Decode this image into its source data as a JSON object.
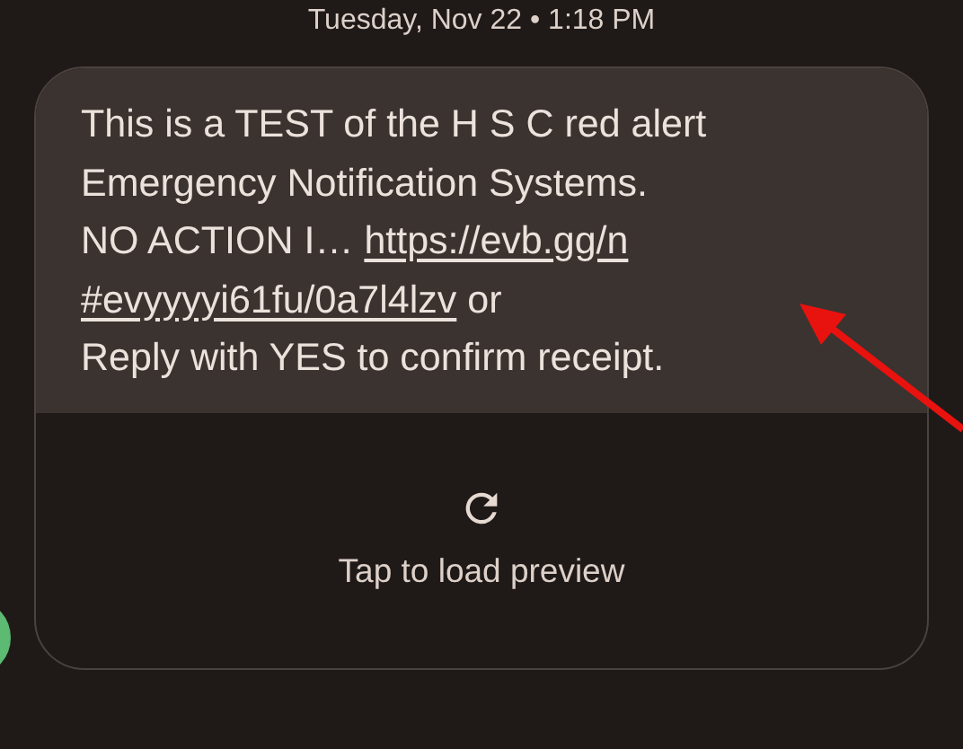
{
  "timestamp": "Tuesday, Nov 22 • 1:18 PM",
  "message": {
    "lines": [
      {
        "parts": [
          {
            "kind": "text",
            "text": "This is a TEST of the H S C red alert"
          }
        ]
      },
      {
        "parts": [
          {
            "kind": "text",
            "text": "Emergency Notification Systems."
          }
        ]
      },
      {
        "parts": [
          {
            "kind": "text",
            "text": "NO ACTION I… "
          },
          {
            "kind": "link",
            "text": "https://evb.gg/n"
          }
        ]
      },
      {
        "parts": [
          {
            "kind": "link",
            "text": "#evyyyyi61fu/0a7l4lzv"
          },
          {
            "kind": "text",
            "text": " or"
          }
        ]
      },
      {
        "parts": [
          {
            "kind": "text",
            "text": "Reply with YES to confirm receipt."
          }
        ]
      }
    ]
  },
  "preview": {
    "label": "Tap to load preview"
  }
}
